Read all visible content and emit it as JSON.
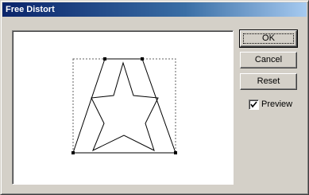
{
  "window": {
    "title": "Free Distort"
  },
  "buttons": {
    "ok_label": "OK",
    "cancel_label": "Cancel",
    "reset_label": "Reset"
  },
  "preview": {
    "label": "Preview",
    "checked": true
  },
  "colors": {
    "title_start": "#0a246a",
    "title_end": "#a6caf0",
    "face": "#d4d0c8"
  }
}
